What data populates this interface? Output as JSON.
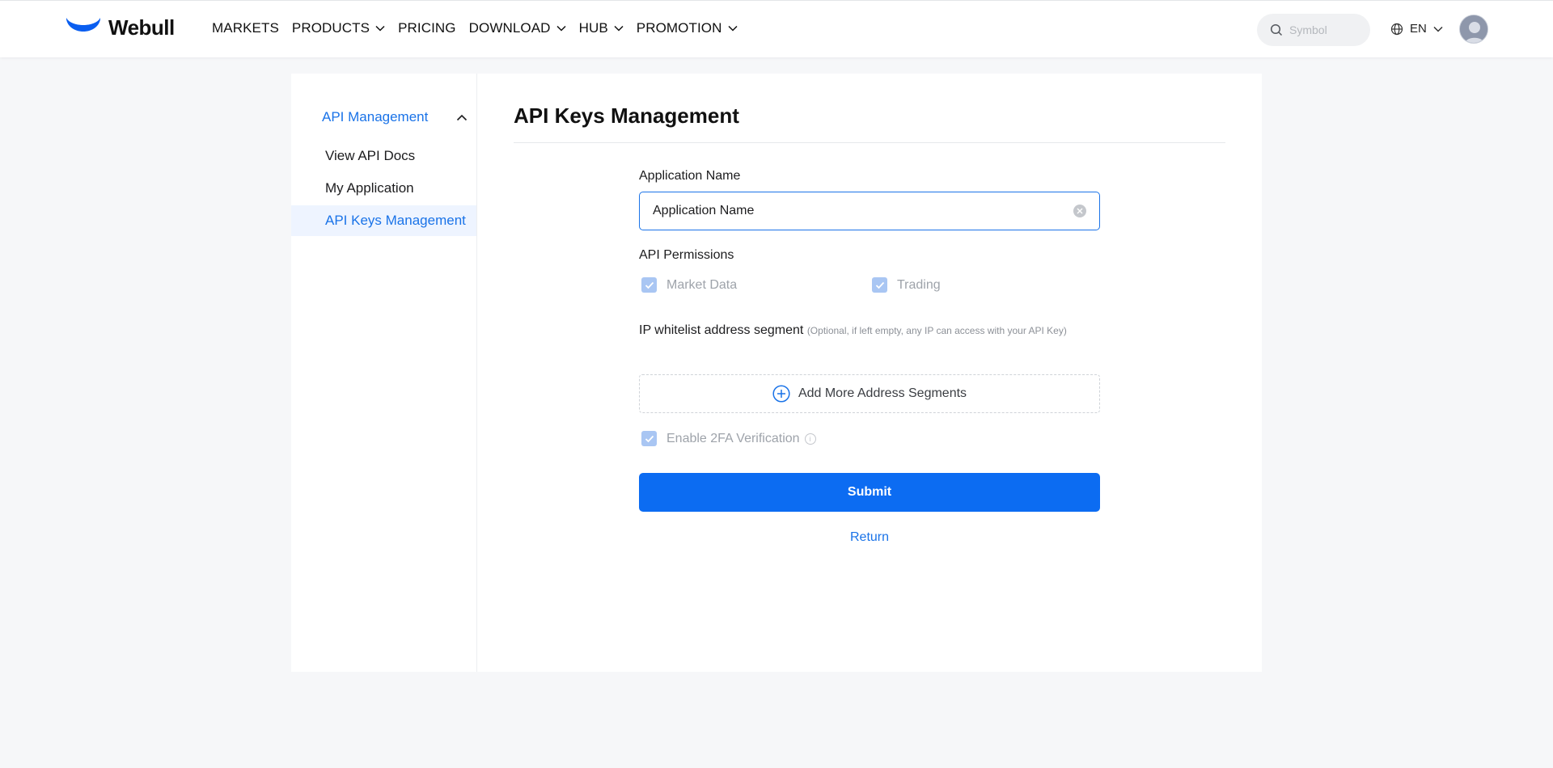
{
  "header": {
    "brand": "Webull",
    "nav": [
      {
        "label": "MARKETS",
        "dropdown": false
      },
      {
        "label": "PRODUCTS",
        "dropdown": true
      },
      {
        "label": "PRICING",
        "dropdown": false
      },
      {
        "label": "DOWNLOAD",
        "dropdown": true
      },
      {
        "label": "HUB",
        "dropdown": true
      },
      {
        "label": "PROMOTION",
        "dropdown": true
      }
    ],
    "search_placeholder": "Symbol",
    "language": "EN"
  },
  "sidebar": {
    "group_label": "API Management",
    "items": [
      {
        "label": "View API Docs",
        "active": false
      },
      {
        "label": "My Application",
        "active": false
      },
      {
        "label": "API Keys Management",
        "active": true
      }
    ]
  },
  "main": {
    "title": "API Keys Management",
    "form": {
      "app_name_label": "Application Name",
      "app_name_value": "Application Name",
      "permissions_label": "API Permissions",
      "permissions": [
        {
          "label": "Market Data",
          "checked": true
        },
        {
          "label": "Trading",
          "checked": true
        }
      ],
      "ip_label": "IP whitelist address segment",
      "ip_hint": "(Optional, if left empty, any IP can access with your API Key)",
      "add_segments_label": "Add More Address Segments",
      "twofa_label": "Enable 2FA Verification",
      "twofa_checked": true,
      "submit_label": "Submit",
      "return_label": "Return"
    }
  },
  "colors": {
    "accent": "#1a73e8",
    "primary_button": "#0c6cf2",
    "disabled_checkbox": "#a9c6f3",
    "page_background": "#f6f7f9"
  }
}
